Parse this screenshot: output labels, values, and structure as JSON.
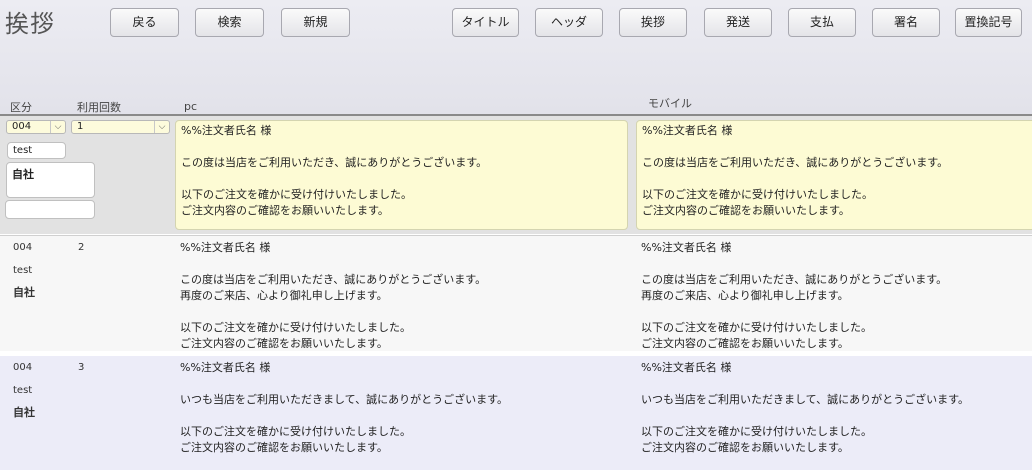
{
  "header": {
    "title": "挨拶",
    "buttons": {
      "back": "戻る",
      "search": "検索",
      "new": "新規",
      "title_btn": "タイトル",
      "header_btn": "ヘッダ",
      "greeting": "挨拶",
      "shipping": "発送",
      "payment": "支払",
      "signature": "署名",
      "replace_code": "置換記号"
    }
  },
  "columns": {
    "category": "区分",
    "usage_count": "利用回数",
    "pc": "pc",
    "mobile": "モバイル"
  },
  "rows": [
    {
      "category": "004",
      "usage_count": "1",
      "name": "test",
      "owner": "自社",
      "extra": "",
      "pc": "%%注文者氏名 様\n\nこの度は当店をご利用いただき、誠にありがとうございます。\n\n以下のご注文を確かに受け付けいたしました。\nご注文内容のご確認をお願いいたします。",
      "mobile": "%%注文者氏名 様\n\nこの度は当店をご利用いただき、誠にありがとうございます。\n\n以下のご注文を確かに受け付けいたしました。\nご注文内容のご確認をお願いいたします。"
    },
    {
      "category": "004",
      "usage_count": "2",
      "name": "test",
      "owner": "自社",
      "pc": "%%注文者氏名 様\n\nこの度は当店をご利用いただき、誠にありがとうございます。\n再度のご来店、心より御礼申し上げます。\n\n以下のご注文を確かに受け付けいたしました。\nご注文内容のご確認をお願いいたします。",
      "mobile": "%%注文者氏名 様\n\nこの度は当店をご利用いただき、誠にありがとうございます。\n再度のご来店、心より御礼申し上げます。\n\n以下のご注文を確かに受け付けいたしました。\nご注文内容のご確認をお願いいたします。"
    },
    {
      "category": "004",
      "usage_count": "3",
      "name": "test",
      "owner": "自社",
      "pc": "%%注文者氏名 様\n\nいつも当店をご利用いただきまして、誠にありがとうございます。\n\n以下のご注文を確かに受け付けいたしました。\nご注文内容のご確認をお願いいたします。",
      "mobile": "%%注文者氏名 様\n\nいつも当店をご利用いただきまして、誠にありがとうございます。\n\n以下のご注文を確かに受け付けいたしました。\nご注文内容のご確認をお願いいたします。"
    }
  ]
}
